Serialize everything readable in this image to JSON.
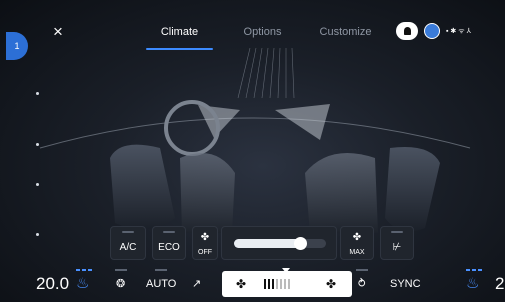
{
  "topbar": {
    "close_label": "×",
    "side_badge": "1",
    "tabs": [
      {
        "label": "Climate",
        "active": true
      },
      {
        "label": "Options",
        "active": false
      },
      {
        "label": "Customize",
        "active": false
      }
    ],
    "status_icons": [
      "bell-icon",
      "avatar-icon",
      "shield-icon",
      "bluetooth-icon",
      "wifi-icon",
      "signal-icon"
    ],
    "status_glyphs": "▪ ✱ ᯤ ⅄"
  },
  "controls": {
    "ac_label": "A/C",
    "eco_label": "ECO",
    "fan_off_label": "OFF",
    "fan_max_label": "MAX",
    "fan_level": 0.72,
    "rear_defrost_glyph": "⊬"
  },
  "bottom": {
    "left_temp": "20.0",
    "left_temp_unit": "",
    "auto_label": "AUTO",
    "sync_label": "SYNC",
    "right_temp": "2",
    "fan_speed_bars": 7,
    "fan_speed_on": 3
  },
  "colors": {
    "accent": "#3d8bff",
    "seat_heat": "#4a90ff"
  }
}
